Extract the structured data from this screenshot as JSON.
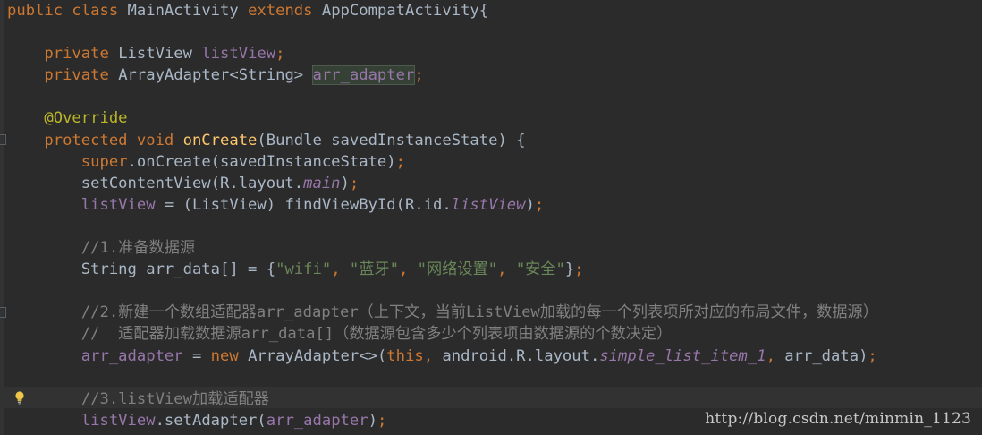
{
  "editor": {
    "lines": [
      [
        [
          "kw",
          "public class "
        ],
        [
          "plain",
          "MainActivity "
        ],
        [
          "kw",
          "extends "
        ],
        [
          "plain",
          "AppCompatActivity{"
        ]
      ],
      [],
      [
        [
          "kw",
          "    private "
        ],
        [
          "plain",
          "ListView "
        ],
        [
          "field",
          "listView"
        ],
        [
          "kw",
          ";"
        ]
      ],
      [
        [
          "kw",
          "    private "
        ],
        [
          "plain",
          "ArrayAdapter<String> "
        ],
        [
          "field-hl",
          "arr_adapter"
        ],
        [
          "kw",
          ";"
        ]
      ],
      [],
      [
        [
          "anno",
          "    @Override"
        ]
      ],
      [
        [
          "kw",
          "    protected void "
        ],
        [
          "fn",
          "onCreate"
        ],
        [
          "plain",
          "(Bundle savedInstanceState) {"
        ]
      ],
      [
        [
          "kw",
          "        super"
        ],
        [
          "plain",
          ".onCreate(savedInstanceState)"
        ],
        [
          "kw",
          ";"
        ]
      ],
      [
        [
          "plain",
          "        setContentView(R.layout."
        ],
        [
          "italic-field",
          "main"
        ],
        [
          "plain",
          ")"
        ],
        [
          "kw",
          ";"
        ]
      ],
      [
        [
          "field",
          "        listView "
        ],
        [
          "plain",
          "= (ListView) findViewById(R.id."
        ],
        [
          "italic-field",
          "listView"
        ],
        [
          "plain",
          ")"
        ],
        [
          "kw",
          ";"
        ]
      ],
      [],
      [
        [
          "cmt",
          "        //1.准备数据源"
        ]
      ],
      [
        [
          "plain",
          "        String arr_data[] = {"
        ],
        [
          "str",
          "\"wifi\""
        ],
        [
          "kw",
          ", "
        ],
        [
          "str",
          "\"蓝牙\""
        ],
        [
          "kw",
          ", "
        ],
        [
          "str",
          "\"网络设置\""
        ],
        [
          "kw",
          ", "
        ],
        [
          "str",
          "\"安全\""
        ],
        [
          "plain",
          "}"
        ],
        [
          "kw",
          ";"
        ]
      ],
      [],
      [
        [
          "cmt",
          "        //2.新建一个数组适配器arr_adapter（上下文，当前ListView加载的每一个列表项所对应的布局文件，数据源）"
        ]
      ],
      [
        [
          "cmt",
          "        //  适配器加载数据源arr_data[]（数据源包含多少个列表项由数据源的个数决定）"
        ]
      ],
      [
        [
          "field",
          "        arr_adapter "
        ],
        [
          "plain",
          "= "
        ],
        [
          "kw",
          "new "
        ],
        [
          "plain",
          "ArrayAdapter<>("
        ],
        [
          "kw",
          "this, "
        ],
        [
          "plain",
          "android.R.layout."
        ],
        [
          "italic-field",
          "simple_list_item_1"
        ],
        [
          "kw",
          ", "
        ],
        [
          "plain",
          "arr_data)"
        ],
        [
          "kw",
          ";"
        ]
      ],
      [],
      [
        [
          "cmt",
          "        //3.listView加载适配器"
        ]
      ],
      [
        [
          "field",
          "        listView"
        ],
        [
          "plain",
          ".setAdapter("
        ],
        [
          "field",
          "arr_adapter"
        ],
        [
          "plain",
          ")"
        ],
        [
          "kw",
          ";"
        ]
      ]
    ]
  },
  "watermark": "http://blog.csdn.net/minmin_1123",
  "icons": {
    "intention": "lightbulb-icon"
  },
  "colors": {
    "background": "#2b2b2b",
    "keyword": "#cc7832",
    "plain": "#a9b7c6",
    "field": "#9876aa",
    "method": "#ffc66d",
    "annotation": "#bbb529",
    "string": "#6a8759",
    "comment": "#808080"
  }
}
